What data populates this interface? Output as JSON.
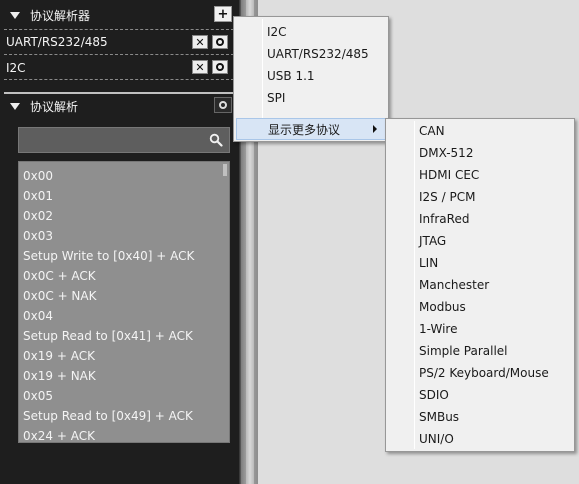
{
  "panel": {
    "analyzers_section": {
      "title": "协议解析器",
      "add_label": "+"
    },
    "analyzers": [
      {
        "name": "UART/RS232/485",
        "close_label": "✕"
      },
      {
        "name": "I2C",
        "close_label": "✕"
      }
    ],
    "decode_section": {
      "title": "协议解析"
    },
    "search": {
      "placeholder": "",
      "value": ""
    },
    "results": [
      "0x00",
      "0x01",
      "0x02",
      "0x03",
      "Setup Write to [0x40] + ACK",
      "0x0C + ACK",
      "0x0C + NAK",
      "0x04",
      "Setup Read to [0x41] + ACK",
      "0x19 + ACK",
      "0x19 + NAK",
      "0x05",
      "Setup Read to [0x49] + ACK",
      "0x24 + ACK"
    ]
  },
  "add_menu": {
    "items": [
      "I2C",
      "UART/RS232/485",
      "USB 1.1",
      "SPI"
    ],
    "more_label": "显示更多协议"
  },
  "more_menu": {
    "items": [
      "CAN",
      "DMX-512",
      "HDMI CEC",
      "I2S / PCM",
      "InfraRed",
      "JTAG",
      "LIN",
      "Manchester",
      "Modbus",
      "1-Wire",
      "Simple Parallel",
      "PS/2 Keyboard/Mouse",
      "SDIO",
      "SMBus",
      "UNI/O"
    ]
  },
  "colors": {
    "panel_bg": "#1e1e1e",
    "results_bg": "#8f8f8f",
    "menu_bg": "#f0f0f0",
    "menu_highlight": "#d8e5f5"
  }
}
